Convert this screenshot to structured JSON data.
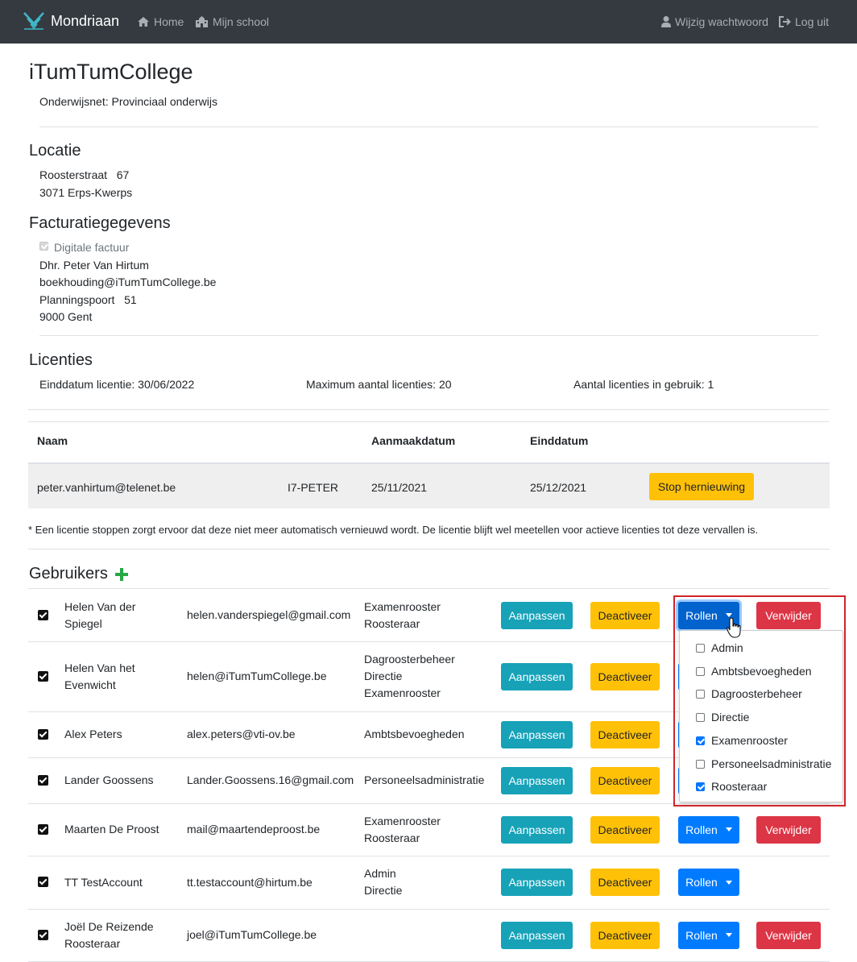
{
  "navbar": {
    "brand": "Mondriaan",
    "home": "Home",
    "school": "Mijn school",
    "password": "Wijzig wachtwoord",
    "logout": "Log uit",
    "bg_color": "#343a40"
  },
  "school": {
    "name": "iTumTumCollege",
    "network": "Onderwijsnet: Provinciaal onderwijs"
  },
  "location": {
    "heading": "Locatie",
    "street": "Roosterstraat",
    "number": "67",
    "city": "3071 Erps-Kwerps"
  },
  "billing": {
    "heading": "Facturatiegegevens",
    "digital_label": "Digitale factuur",
    "digital_checked": true,
    "contact": "Dhr. Peter Van Hirtum",
    "email": "boekhouding@iTumTumCollege.be",
    "street": "Planningspoort",
    "number": "51",
    "city": "9000 Gent"
  },
  "licenses": {
    "heading": "Licenties",
    "end_date": "Einddatum licentie: 30/06/2022",
    "max": "Maximum aantal licenties: 20",
    "in_use": "Aantal licenties in gebruik: 1",
    "columns": {
      "name": "Naam",
      "created": "Aanmaakdatum",
      "end": "Einddatum"
    },
    "row": {
      "email": "peter.vanhirtum@telenet.be",
      "code": "I7-PETER",
      "created": "25/11/2021",
      "end": "25/12/2021",
      "button": "Stop hernieuwing"
    },
    "footnote": "* Een licentie stoppen zorgt ervoor dat deze niet meer automatisch vernieuwd wordt. De licentie blijft wel meetellen voor actieve licenties tot deze vervallen is."
  },
  "users": {
    "heading": "Gebruikers",
    "add_icon": "plus-icon",
    "buttons": {
      "edit": "Aanpassen",
      "deactivate": "Deactiveer",
      "roles": "Rollen",
      "delete": "Verwijder"
    },
    "rows": [
      {
        "name1": "Helen Van der",
        "name2": "Spiegel",
        "email": "helen.vanderspiegel@gmail.com",
        "role1": "Examenrooster",
        "role2": "Roosteraar",
        "role3": "",
        "checked": true
      },
      {
        "name1": "Helen Van het",
        "name2": "Evenwicht",
        "email": "helen@iTumTumCollege.be",
        "role1": "Dagroosterbeheer",
        "role2": "Directie",
        "role3": "Examenrooster",
        "checked": true
      },
      {
        "name1": "Alex Peters",
        "name2": "",
        "email": "alex.peters@vti-ov.be",
        "role1": "Ambtsbevoegheden",
        "role2": "",
        "role3": "",
        "checked": true
      },
      {
        "name1": "Lander Goossens",
        "name2": "",
        "email": "Lander.Goossens.16@gmail.com",
        "role1": "Personeelsadministratie",
        "role2": "",
        "role3": "",
        "checked": true
      },
      {
        "name1": "Maarten De Proost",
        "name2": "",
        "email": "mail@maartendeproost.be",
        "role1": "Examenrooster",
        "role2": "Roosteraar",
        "role3": "",
        "checked": true
      },
      {
        "name1": "TT TestAccount",
        "name2": "",
        "email": "tt.testaccount@hirtum.be",
        "role1": "Admin",
        "role2": "Directie",
        "role3": "",
        "checked": true
      },
      {
        "name1": "Joël De Reizende",
        "name2": "Roosteraar",
        "email": "joel@iTumTumCollege.be",
        "role1": "",
        "role2": "",
        "role3": "",
        "checked": true
      }
    ]
  },
  "roles_dropdown": {
    "options": [
      {
        "label": "Admin",
        "checked": false
      },
      {
        "label": "Ambtsbevoegheden",
        "checked": false
      },
      {
        "label": "Dagroosterbeheer",
        "checked": false
      },
      {
        "label": "Directie",
        "checked": false
      },
      {
        "label": "Examenrooster",
        "checked": true
      },
      {
        "label": "Personeelsadministratie",
        "checked": false
      },
      {
        "label": "Roosteraar",
        "checked": true
      }
    ]
  },
  "colors": {
    "warning": "#ffc107",
    "info": "#17a2b8",
    "primary": "#007bff",
    "danger": "#dc3545",
    "success": "#28a745"
  }
}
